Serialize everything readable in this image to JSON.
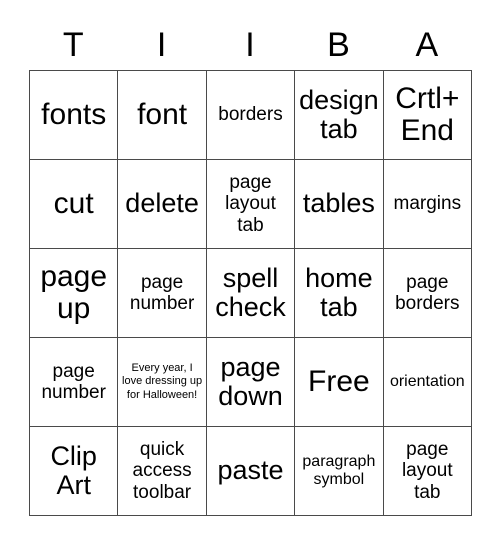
{
  "card": {
    "header_letters": [
      "T",
      "I",
      "I",
      "B",
      "A"
    ],
    "border_color": "#4a4a4a",
    "background_color": "#ffffff",
    "text_color": "#000000",
    "rows": [
      [
        {
          "text": "fonts",
          "size": "xl"
        },
        {
          "text": "font",
          "size": "xl"
        },
        {
          "text": "borders",
          "size": "md"
        },
        {
          "text": "design tab",
          "size": "lg"
        },
        {
          "text": "Crtl+ End",
          "size": "xl"
        }
      ],
      [
        {
          "text": "cut",
          "size": "xl"
        },
        {
          "text": "delete",
          "size": "lg"
        },
        {
          "text": "page layout tab",
          "size": "md"
        },
        {
          "text": "tables",
          "size": "lg"
        },
        {
          "text": "margins",
          "size": "md"
        }
      ],
      [
        {
          "text": "page up",
          "size": "xl"
        },
        {
          "text": "page number",
          "size": "md"
        },
        {
          "text": "spell check",
          "size": "lg"
        },
        {
          "text": "home tab",
          "size": "lg"
        },
        {
          "text": "page borders",
          "size": "md"
        }
      ],
      [
        {
          "text": "page number",
          "size": "md"
        },
        {
          "text": "Every year, I love dressing up for Halloween!",
          "size": "xs"
        },
        {
          "text": "page down",
          "size": "lg"
        },
        {
          "text": "Free",
          "size": "xl"
        },
        {
          "text": "orientation",
          "size": "sm"
        }
      ],
      [
        {
          "text": "Clip Art",
          "size": "lg"
        },
        {
          "text": "quick access toolbar",
          "size": "md"
        },
        {
          "text": "paste",
          "size": "lg"
        },
        {
          "text": "paragraph symbol",
          "size": "sm"
        },
        {
          "text": "page layout tab",
          "size": "md"
        }
      ]
    ]
  }
}
